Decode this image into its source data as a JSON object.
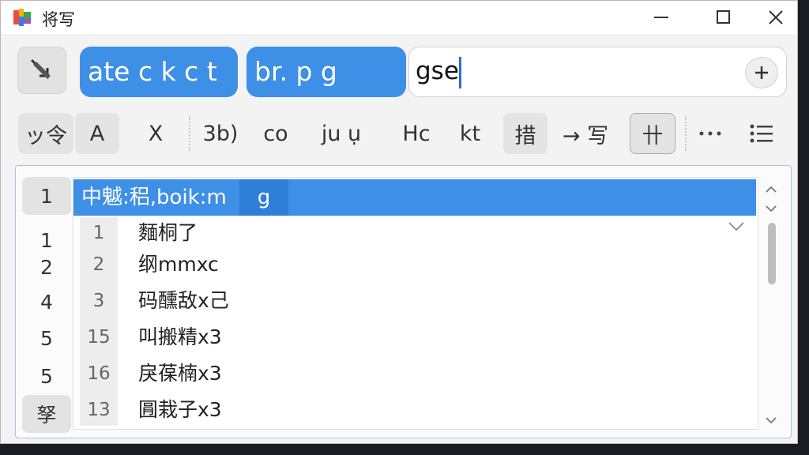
{
  "window": {
    "title": "将写"
  },
  "toolbar": {
    "chip1": "ate c  k c t",
    "chip2": "br. p   g",
    "search_value": "gse"
  },
  "toolbar2": {
    "items": [
      "ッ令",
      "A",
      "X",
      "3b)",
      "co",
      "ju  ụ",
      "Hc",
      "kt",
      "措",
      "→ 写",
      "卄"
    ]
  },
  "list": {
    "selected_row": {
      "text": "中魆:稆,boik:m",
      "highlight": "g"
    },
    "left_numbers": [
      "1",
      "1",
      "2",
      "4",
      "5",
      "5",
      "孥"
    ],
    "rows": [
      {
        "n": "1",
        "text": "麵桐了"
      },
      {
        "n": "2",
        "text": "纲mmxc"
      },
      {
        "n": "3",
        "text": "码醺敌x己"
      },
      {
        "n": "15",
        "text": "叫搬精x3"
      },
      {
        "n": "16",
        "text": "戾葆楠x3"
      },
      {
        "n": "13",
        "text": "㘣栽子x3"
      }
    ]
  },
  "colors": {
    "accent": "#3e8fe6",
    "window_bg": "#f3f3f3"
  }
}
